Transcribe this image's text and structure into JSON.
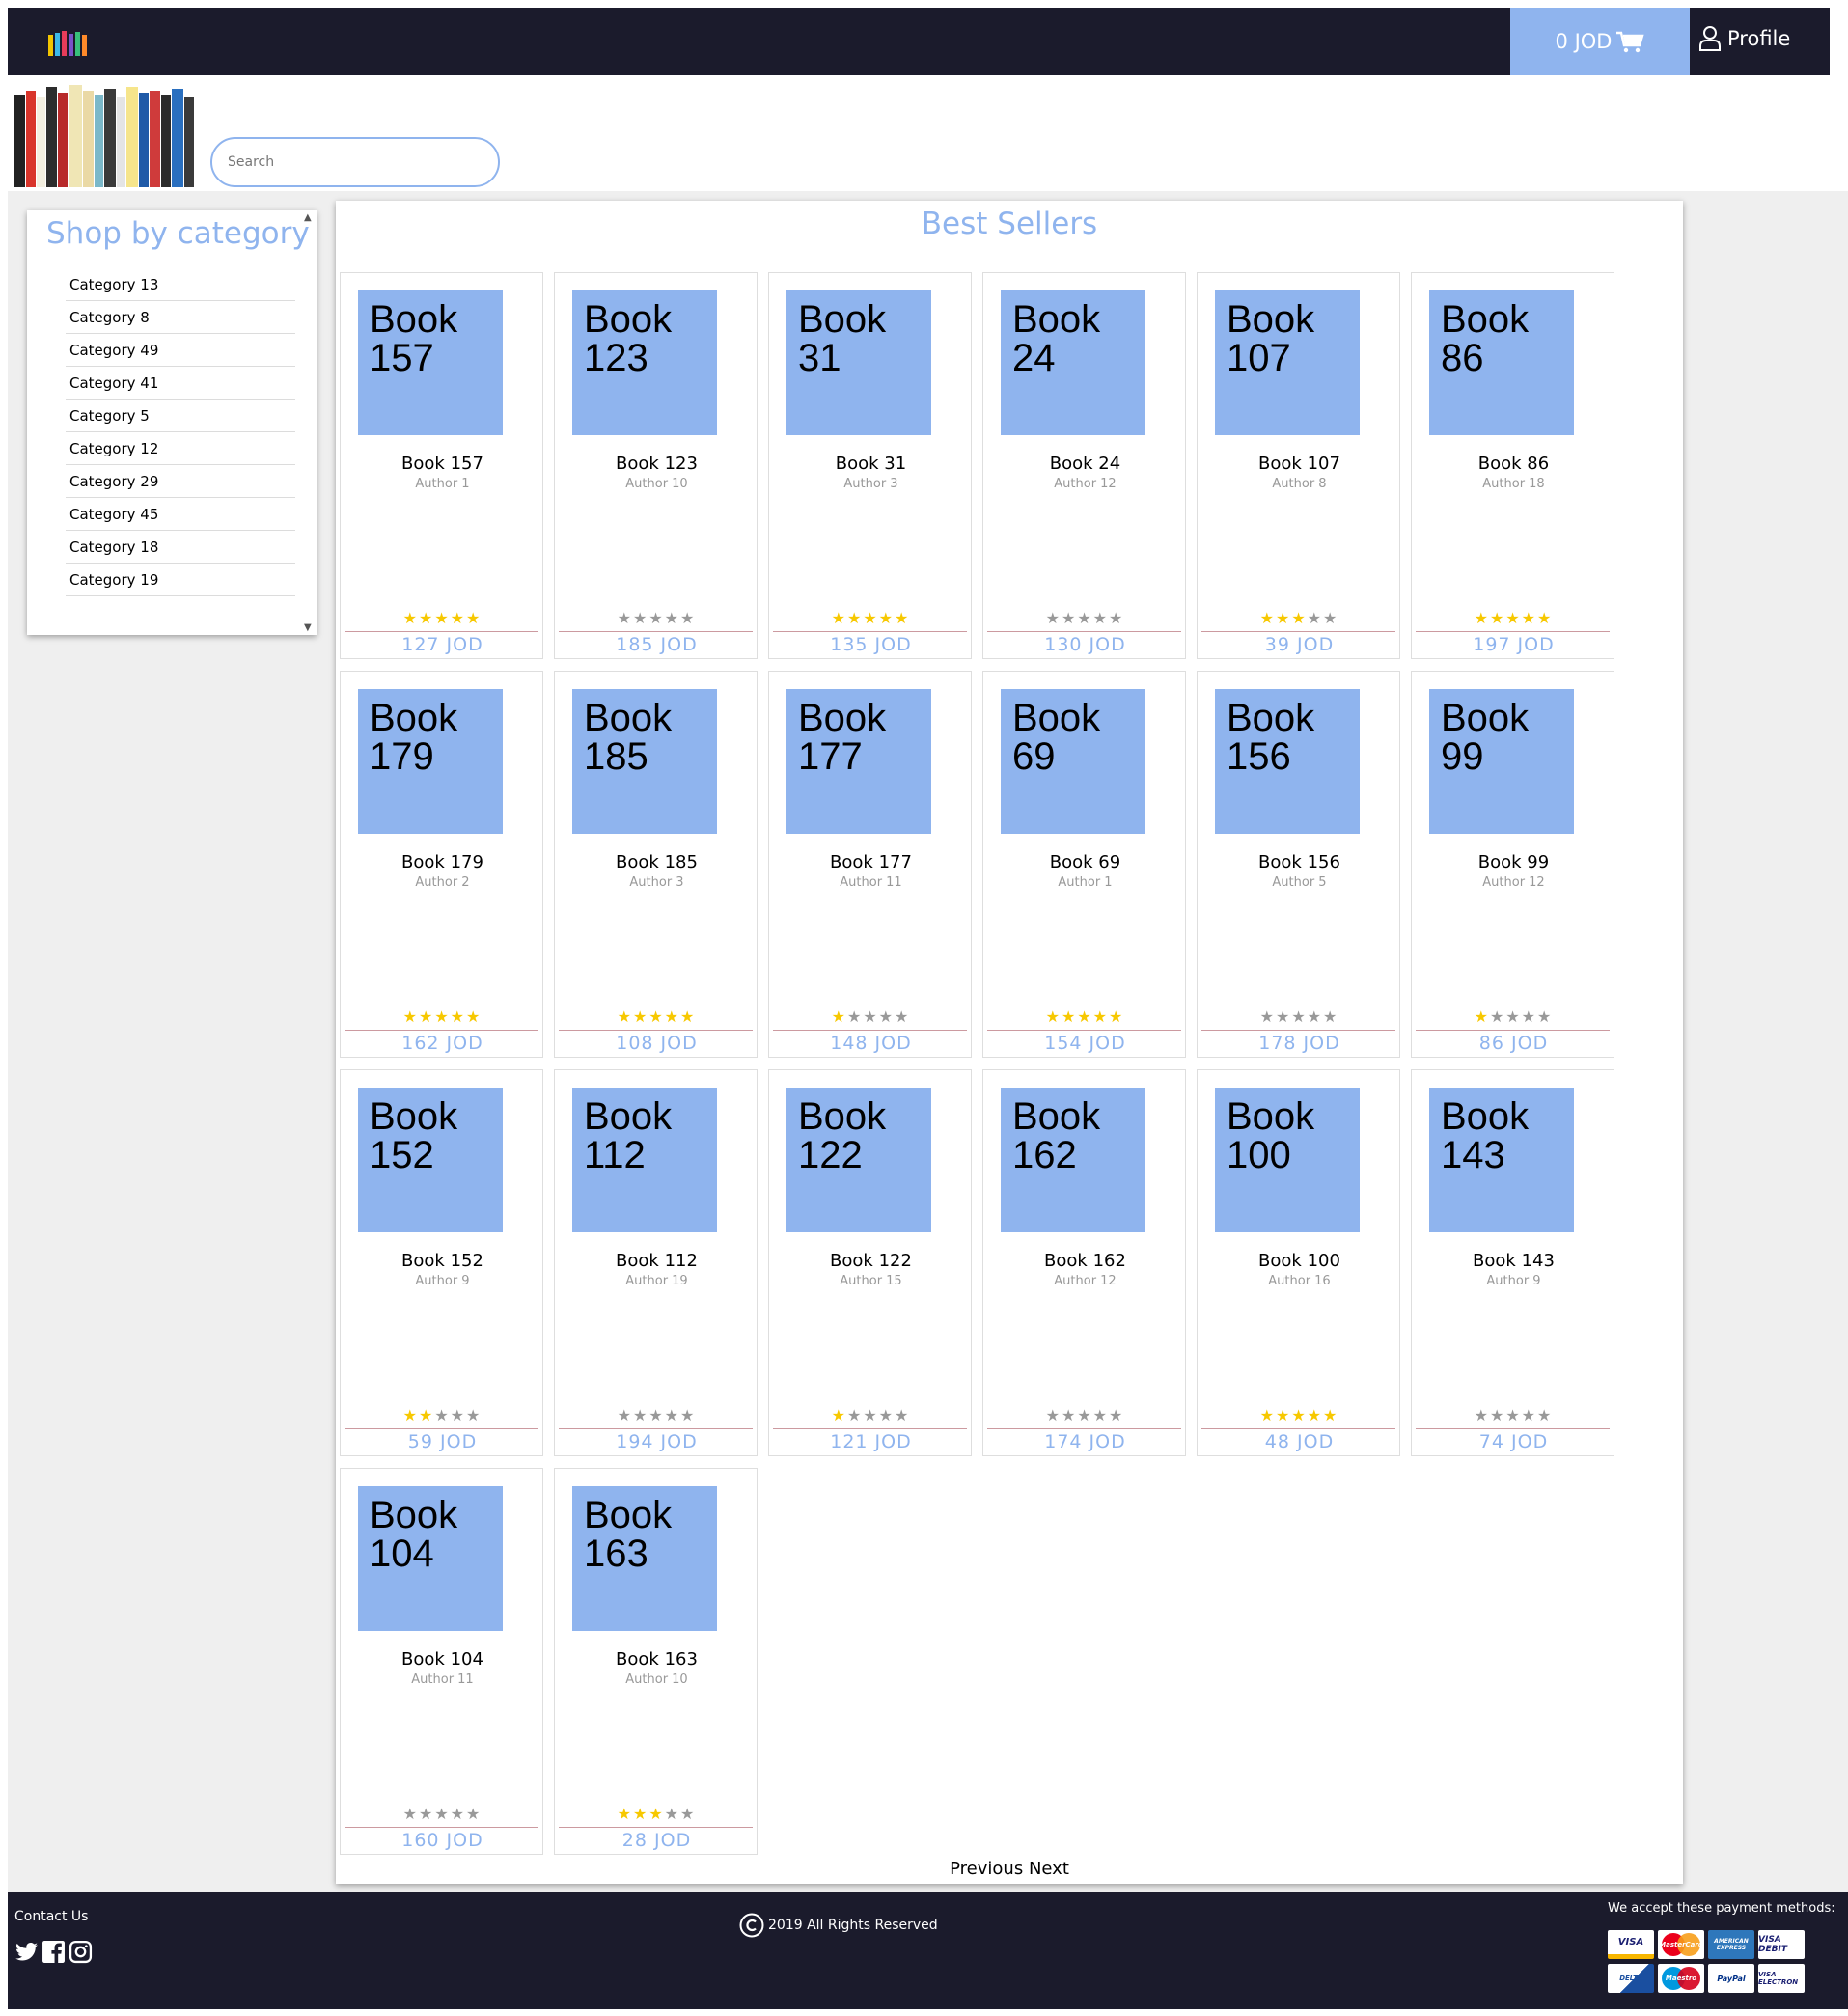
{
  "header": {
    "cart_label": "0 JOD",
    "profile_label": "Profile"
  },
  "search": {
    "placeholder": "Search"
  },
  "sidebar": {
    "title": "Shop by category",
    "categories": [
      "Category 13",
      "Category 8",
      "Category 49",
      "Category 41",
      "Category 5",
      "Category 12",
      "Category 29",
      "Category 45",
      "Category 18",
      "Category 19"
    ]
  },
  "main": {
    "title": "Best Sellers",
    "books": [
      {
        "cover": "Book 157",
        "title": "Book 157",
        "author": "Author 1",
        "rating": 5,
        "price": "127 JOD"
      },
      {
        "cover": "Book 123",
        "title": "Book 123",
        "author": "Author 10",
        "rating": 0,
        "price": "185 JOD"
      },
      {
        "cover": "Book 31",
        "title": "Book 31",
        "author": "Author 3",
        "rating": 5,
        "price": "135 JOD"
      },
      {
        "cover": "Book 24",
        "title": "Book 24",
        "author": "Author 12",
        "rating": 0,
        "price": "130 JOD"
      },
      {
        "cover": "Book 107",
        "title": "Book 107",
        "author": "Author 8",
        "rating": 3,
        "price": "39 JOD"
      },
      {
        "cover": "Book 86",
        "title": "Book 86",
        "author": "Author 18",
        "rating": 5,
        "price": "197 JOD"
      },
      {
        "cover": "Book 179",
        "title": "Book 179",
        "author": "Author 2",
        "rating": 5,
        "price": "162 JOD"
      },
      {
        "cover": "Book 185",
        "title": "Book 185",
        "author": "Author 3",
        "rating": 5,
        "price": "108 JOD"
      },
      {
        "cover": "Book 177",
        "title": "Book 177",
        "author": "Author 11",
        "rating": 1,
        "price": "148 JOD"
      },
      {
        "cover": "Book 69",
        "title": "Book 69",
        "author": "Author 1",
        "rating": 5,
        "price": "154 JOD"
      },
      {
        "cover": "Book 156",
        "title": "Book 156",
        "author": "Author 5",
        "rating": 0,
        "price": "178 JOD"
      },
      {
        "cover": "Book 99",
        "title": "Book 99",
        "author": "Author 12",
        "rating": 1,
        "price": "86 JOD"
      },
      {
        "cover": "Book 152",
        "title": "Book 152",
        "author": "Author 9",
        "rating": 2,
        "price": "59 JOD"
      },
      {
        "cover": "Book 112",
        "title": "Book 112",
        "author": "Author 19",
        "rating": 0,
        "price": "194 JOD"
      },
      {
        "cover": "Book 122",
        "title": "Book 122",
        "author": "Author 15",
        "rating": 1,
        "price": "121 JOD"
      },
      {
        "cover": "Book 162",
        "title": "Book 162",
        "author": "Author 12",
        "rating": 0,
        "price": "174 JOD"
      },
      {
        "cover": "Book 100",
        "title": "Book 100",
        "author": "Author 16",
        "rating": 5,
        "price": "48 JOD"
      },
      {
        "cover": "Book 143",
        "title": "Book 143",
        "author": "Author 9",
        "rating": 0,
        "price": "74 JOD"
      },
      {
        "cover": "Book 104",
        "title": "Book 104",
        "author": "Author 11",
        "rating": 0,
        "price": "160 JOD"
      },
      {
        "cover": "Book 163",
        "title": "Book 163",
        "author": "Author 10",
        "rating": 3,
        "price": "28 JOD"
      }
    ],
    "pagination": {
      "previous_label": "Previous",
      "next_label": "Next"
    }
  },
  "footer": {
    "contact_label": "Contact Us",
    "copyright": "2019 All Rights Reserved",
    "payment_label": "We accept these payment methods:",
    "payment_cards": [
      "VISA",
      "MasterCard",
      "AMERICAN EXPRESS",
      "VISA DEBIT",
      "DELTA",
      "Maestro",
      "PayPal",
      "VISA ELECTRON"
    ],
    "social_icons": [
      "twitter-icon",
      "facebook-icon",
      "instagram-icon"
    ]
  },
  "colors": {
    "accent": "#8fb4ee",
    "dark_bar": "#1b1b2c",
    "star_on": "#f7c800",
    "star_off": "#999999"
  }
}
